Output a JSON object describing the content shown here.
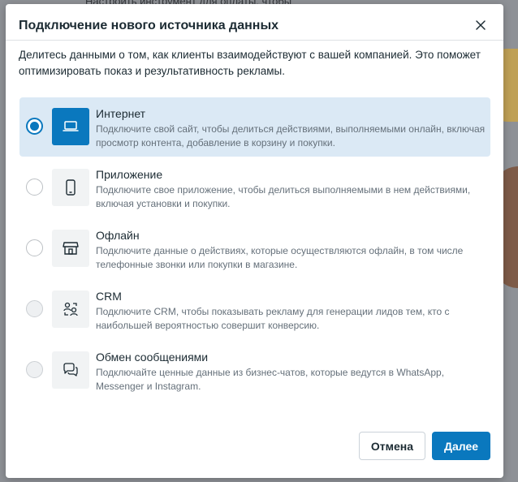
{
  "background": {
    "partial_text": "Настроить инструмент для оплаты, чтобы"
  },
  "dialog": {
    "title": "Подключение нового источника данных",
    "close_icon": "close-icon",
    "description": "Делитесь данными о том, как клиенты взаимодействуют с вашей компанией. Это поможет оптимизировать показ и результативность рекламы.",
    "options": [
      {
        "icon": "laptop-icon",
        "title": "Интернет",
        "description": "Подключите свой сайт, чтобы делиться действиями, выполняемыми онлайн, включая просмотр контента, добавление в корзину и покупки.",
        "selected": true
      },
      {
        "icon": "smartphone-icon",
        "title": "Приложение",
        "description": "Подключите свое приложение, чтобы делиться выполняемыми в нем действиями, включая установки и покупки.",
        "selected": false
      },
      {
        "icon": "store-icon",
        "title": "Офлайн",
        "description": "Подключите данные о действиях, которые осуществляются офлайн, в том числе телефонные звонки или покупки в магазине.",
        "selected": false
      },
      {
        "icon": "crm-users-icon",
        "title": "CRM",
        "description": "Подключите CRM, чтобы показывать рекламу для генерации лидов тем, кто с наибольшей вероятностью совершит конверсию.",
        "selected": false,
        "disabled": true
      },
      {
        "icon": "chat-bubbles-icon",
        "title": "Обмен сообщениями",
        "description": "Подключайте ценные данные из бизнес-чатов, которые ведутся в WhatsApp, Messenger и Instagram.",
        "selected": false,
        "disabled": true
      }
    ],
    "buttons": {
      "cancel": "Отмена",
      "next": "Далее"
    }
  },
  "colors": {
    "accent": "#0a78be",
    "selected_bg": "#dbe9f5",
    "text_primary": "#1c2b33",
    "text_secondary": "#65707a"
  }
}
